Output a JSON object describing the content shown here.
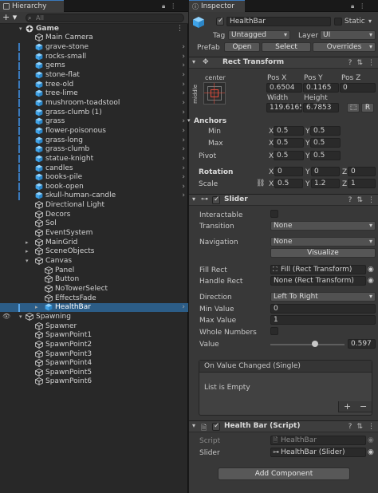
{
  "hierarchy": {
    "tab_label": "Hierarchy",
    "search_placeholder": "All",
    "add_label": "+ ▾",
    "rows": [
      {
        "label": "Game",
        "depth": 0,
        "kind": "root"
      },
      {
        "label": "Main Camera",
        "depth": 1,
        "kind": "obj"
      },
      {
        "label": "grave-stone",
        "depth": 1,
        "kind": "prefab",
        "chev": true
      },
      {
        "label": "rocks-small",
        "depth": 1,
        "kind": "prefab",
        "chev": true
      },
      {
        "label": "gems",
        "depth": 1,
        "kind": "prefab",
        "chev": true
      },
      {
        "label": "stone-flat",
        "depth": 1,
        "kind": "prefab",
        "chev": true
      },
      {
        "label": "tree-old",
        "depth": 1,
        "kind": "prefab",
        "chev": true
      },
      {
        "label": "tree-lime",
        "depth": 1,
        "kind": "prefab",
        "chev": true
      },
      {
        "label": "mushroom-toadstool",
        "depth": 1,
        "kind": "prefab",
        "chev": true
      },
      {
        "label": "grass-clumb (1)",
        "depth": 1,
        "kind": "prefab",
        "chev": true
      },
      {
        "label": "grass",
        "depth": 1,
        "kind": "prefab",
        "chev": true
      },
      {
        "label": "flower-poisonous",
        "depth": 1,
        "kind": "prefab",
        "chev": true
      },
      {
        "label": "grass-long",
        "depth": 1,
        "kind": "prefab",
        "chev": true
      },
      {
        "label": "grass-clumb",
        "depth": 1,
        "kind": "prefab",
        "chev": true
      },
      {
        "label": "statue-knight",
        "depth": 1,
        "kind": "prefab",
        "chev": true
      },
      {
        "label": "candles",
        "depth": 1,
        "kind": "prefab",
        "chev": true
      },
      {
        "label": "books-pile",
        "depth": 1,
        "kind": "prefab",
        "chev": true
      },
      {
        "label": "book-open",
        "depth": 1,
        "kind": "prefab",
        "chev": true
      },
      {
        "label": "skull-human-candle",
        "depth": 1,
        "kind": "prefab",
        "chev": true
      },
      {
        "label": "Directional Light",
        "depth": 1,
        "kind": "obj"
      },
      {
        "label": "Decors",
        "depth": 1,
        "kind": "obj"
      },
      {
        "label": "Sol",
        "depth": 1,
        "kind": "obj"
      },
      {
        "label": "EventSystem",
        "depth": 1,
        "kind": "obj"
      },
      {
        "label": "MainGrid",
        "depth": 1,
        "kind": "obj",
        "arrow": "▸"
      },
      {
        "label": "SceneObjects",
        "depth": 1,
        "kind": "obj",
        "arrow": "▸"
      },
      {
        "label": "Canvas",
        "depth": 1,
        "kind": "obj",
        "arrow": "▾"
      },
      {
        "label": "Panel",
        "depth": 2,
        "kind": "obj"
      },
      {
        "label": "Button",
        "depth": 2,
        "kind": "obj"
      },
      {
        "label": "NoTowerSelect",
        "depth": 2,
        "kind": "obj"
      },
      {
        "label": "EffectsFade",
        "depth": 2,
        "kind": "obj"
      },
      {
        "label": "HealthBar",
        "depth": 2,
        "kind": "prefab",
        "chev": true,
        "selected": true,
        "arrow": "▸"
      },
      {
        "label": "Spawning",
        "depth": 0,
        "kind": "obj",
        "arrow": "▾"
      },
      {
        "label": "Spawner",
        "depth": 1,
        "kind": "obj"
      },
      {
        "label": "SpawnPoint1",
        "depth": 1,
        "kind": "obj"
      },
      {
        "label": "SpawnPoint2",
        "depth": 1,
        "kind": "obj"
      },
      {
        "label": "SpawnPoint3",
        "depth": 1,
        "kind": "obj"
      },
      {
        "label": "SpawnPoint4",
        "depth": 1,
        "kind": "obj"
      },
      {
        "label": "SpawnPoint5",
        "depth": 1,
        "kind": "obj"
      },
      {
        "label": "SpawnPoint6",
        "depth": 1,
        "kind": "obj"
      }
    ]
  },
  "inspector": {
    "tab_label": "Inspector",
    "object_name": "HealthBar",
    "static_label": "Static",
    "tag_label": "Tag",
    "tag_value": "Untagged",
    "layer_label": "Layer",
    "layer_value": "UI",
    "prefab_label": "Prefab",
    "open_label": "Open",
    "select_label": "Select",
    "overrides_label": "Overrides",
    "rect_transform": {
      "title": "Rect Transform",
      "anchor_h": "center",
      "anchor_v": "middle",
      "pos_x_label": "Pos X",
      "pos_y_label": "Pos Y",
      "pos_z_label": "Pos Z",
      "pos_x": "0.6504",
      "pos_y": "0.1165",
      "pos_z": "0",
      "width_label": "Width",
      "height_label": "Height",
      "width": "119.6165",
      "height": "6.7853",
      "anchors_label": "Anchors",
      "min_label": "Min",
      "max_label": "Max",
      "min_x": "0.5",
      "min_y": "0.5",
      "max_x": "0.5",
      "max_y": "0.5",
      "pivot_label": "Pivot",
      "pivot_x": "0.5",
      "pivot_y": "0.5",
      "rotation_label": "Rotation",
      "rot_x": "0",
      "rot_y": "0",
      "rot_z": "0",
      "scale_label": "Scale",
      "scale_x": "0.5",
      "scale_y": "1.2",
      "scale_z": "1",
      "x": "X",
      "y": "Y",
      "z": "Z",
      "r_label": "R"
    },
    "slider": {
      "title": "Slider",
      "interactable_label": "Interactable",
      "transition_label": "Transition",
      "transition_value": "None",
      "navigation_label": "Navigation",
      "navigation_value": "None",
      "visualize_label": "Visualize",
      "fill_rect_label": "Fill Rect",
      "fill_rect_value": "Fill (Rect Transform)",
      "handle_rect_label": "Handle Rect",
      "handle_rect_value": "None (Rect Transform)",
      "direction_label": "Direction",
      "direction_value": "Left To Right",
      "min_value_label": "Min Value",
      "min_value": "0",
      "max_value_label": "Max Value",
      "max_value": "1",
      "whole_numbers_label": "Whole Numbers",
      "value_label": "Value",
      "value": "0.597",
      "value_fraction": 0.597,
      "event_title": "On Value Changed (Single)",
      "event_empty": "List is Empty",
      "plus": "+",
      "minus": "−"
    },
    "script": {
      "title": "Health Bar (Script)",
      "script_label": "Script",
      "script_value": "HealthBar",
      "slider_label": "Slider",
      "slider_value": "HealthBar (Slider)"
    },
    "add_component_label": "Add Component"
  }
}
